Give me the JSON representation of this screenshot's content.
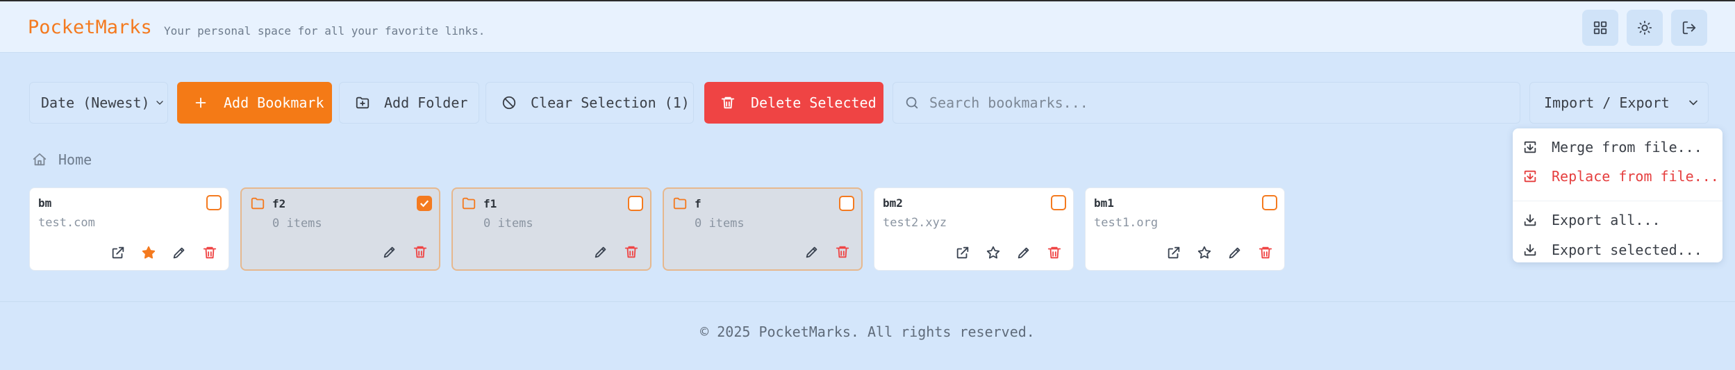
{
  "header": {
    "logo": "PocketMarks",
    "tagline": "Your personal space for all your favorite links.",
    "buttons": [
      {
        "icon": "layout-grid-icon"
      },
      {
        "icon": "sun-icon"
      },
      {
        "icon": "logout-icon"
      }
    ]
  },
  "toolbar": {
    "sort": "Date (Newest)",
    "add_bookmark": "Add Bookmark",
    "add_folder": "Add Folder",
    "clear_selection": "Clear Selection (1)",
    "delete_selected": "Delete Selected",
    "search_placeholder": "Search bookmarks...",
    "import_export": "Import / Export"
  },
  "dropdown": {
    "items": [
      {
        "label": "Merge from file...",
        "icon": "import-icon"
      },
      {
        "label": "Replace from file...",
        "icon": "import-icon",
        "color": "#e53e3e"
      },
      {
        "label": "Export all...",
        "icon": "download-icon"
      },
      {
        "label": "Export selected...",
        "icon": "download-icon"
      }
    ]
  },
  "breadcrumb": {
    "home": "Home"
  },
  "cards": [
    {
      "type": "bookmark",
      "name": "bm",
      "sub": "test.com",
      "checked": false,
      "favorite": true
    },
    {
      "type": "folder",
      "name": "f2",
      "sub": "0 items",
      "checked": true
    },
    {
      "type": "folder",
      "name": "f1",
      "sub": "0 items",
      "checked": false
    },
    {
      "type": "folder",
      "name": "f",
      "sub": "0 items",
      "checked": false
    },
    {
      "type": "bookmark",
      "name": "bm2",
      "sub": "test2.xyz",
      "checked": false,
      "favorite": false
    },
    {
      "type": "bookmark",
      "name": "bm1",
      "sub": "test1.org",
      "checked": false,
      "favorite": false
    }
  ],
  "footer": "© 2025 PocketMarks. All rights reserved.",
  "colors": {
    "accent": "#f47a16",
    "danger": "#ef4444",
    "background": "#d4e6fb"
  }
}
